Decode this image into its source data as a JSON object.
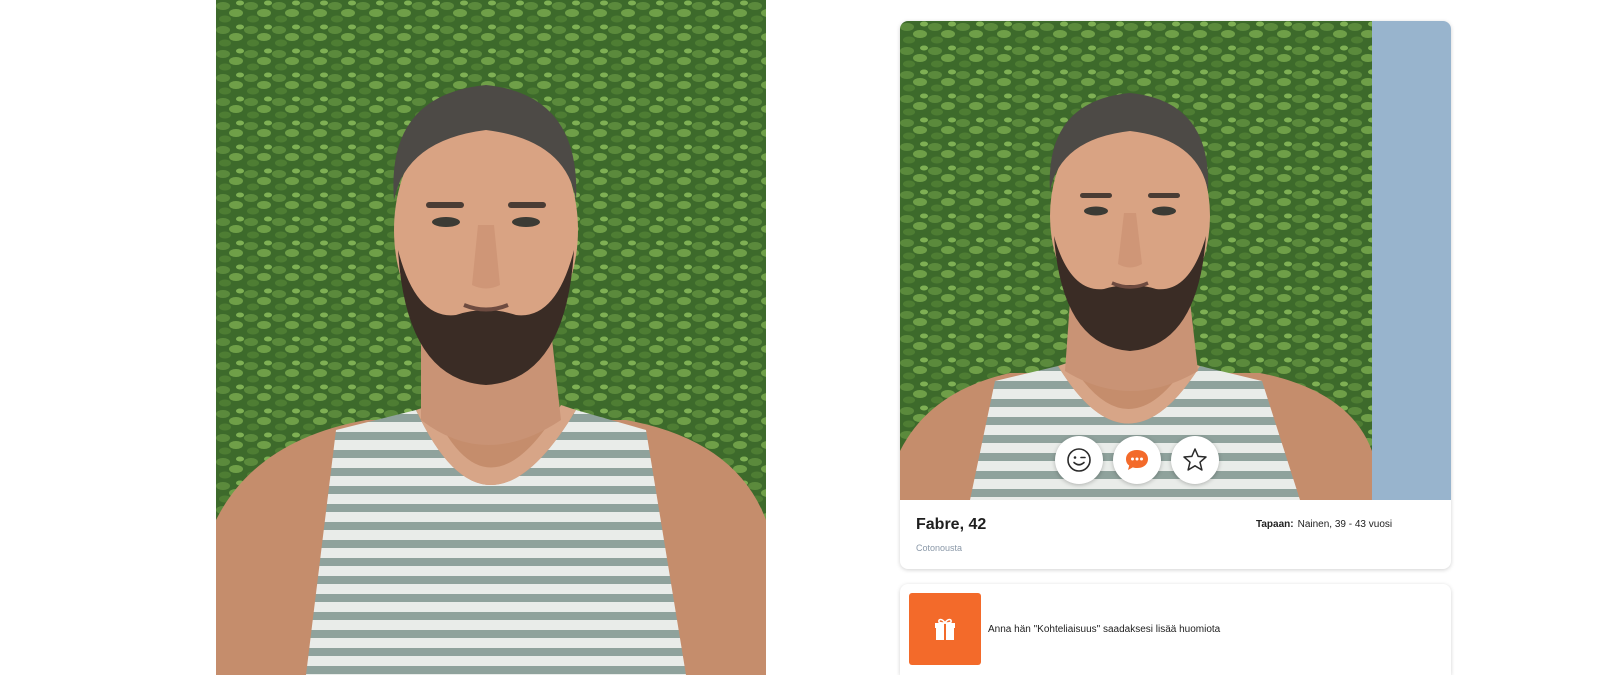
{
  "profile": {
    "name_age": "Fabre, 42",
    "location": "Cotonousta",
    "seeking_label": "Tapaan:",
    "seeking_value": "Nainen, 39 - 43 vuosi"
  },
  "actions": [
    {
      "icon": "wink-face-icon"
    },
    {
      "icon": "chat-bubble-icon"
    },
    {
      "icon": "star-icon"
    }
  ],
  "gift_banner": {
    "icon": "gift-icon",
    "text": "Anna hän \"Kohteliaisuus\" saadaksesi lisää huomiota"
  },
  "colors": {
    "accent": "#f36a2a",
    "side_strip": "#98b4cd",
    "muted_text": "#8a98a8"
  }
}
